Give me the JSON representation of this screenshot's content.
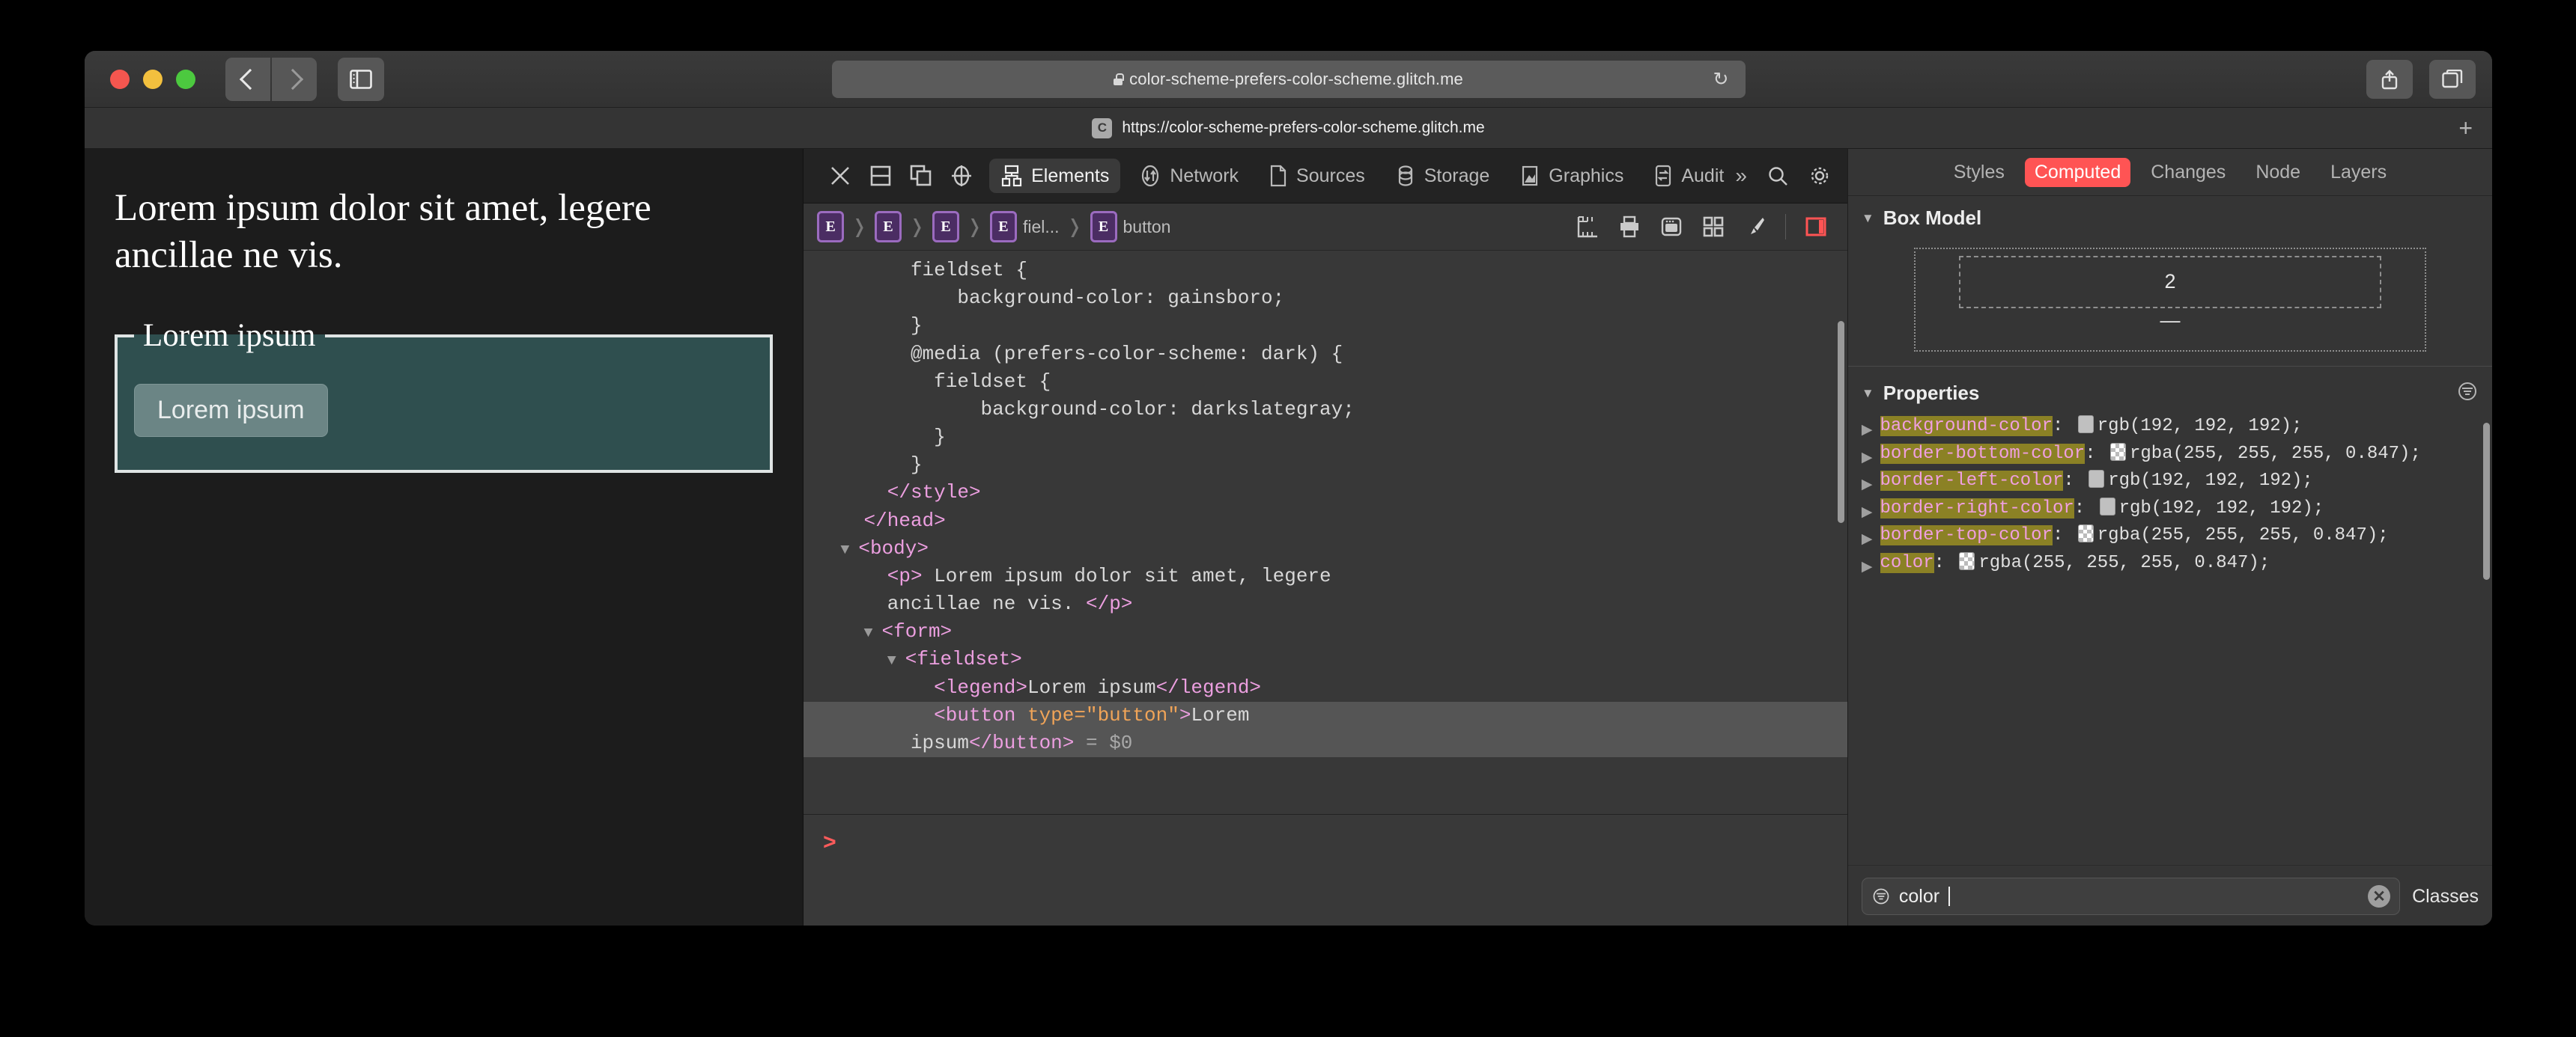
{
  "browser": {
    "url_display": "color-scheme-prefers-color-scheme.glitch.me",
    "reload_icon": "reload-icon",
    "lock_icon": "lock-icon",
    "share_icon": "share-icon",
    "tabs_icon": "tabs-overview-icon",
    "sidebar_icon": "sidebar-toggle-icon",
    "back_icon": "back-chevron-icon",
    "forward_icon": "forward-chevron-icon",
    "new_tab_label": "+",
    "tab": {
      "favicon_letter": "C",
      "title": "https://color-scheme-prefers-color-scheme.glitch.me"
    }
  },
  "page": {
    "paragraph": "Lorem ipsum dolor sit amet, legere ancillae ne vis.",
    "legend": "Lorem ipsum",
    "button_label": "Lorem ipsum",
    "fieldset_bg": "#2f4f4f",
    "border_color": "rgba(255, 255, 255, 0.847)"
  },
  "devtools": {
    "close_icon": "close-icon",
    "dock_bottom_icon": "dock-to-bottom-icon",
    "dock_side_icon": "dock-to-side-icon",
    "inspect_icon": "inspect-element-icon",
    "tabs": [
      {
        "label": "Elements",
        "icon": "elements-tree-icon",
        "active": true
      },
      {
        "label": "Network",
        "icon": "network-arrows-icon",
        "active": false
      },
      {
        "label": "Sources",
        "icon": "sources-document-icon",
        "active": false
      },
      {
        "label": "Storage",
        "icon": "storage-database-icon",
        "active": false
      },
      {
        "label": "Graphics",
        "icon": "graphics-image-icon",
        "active": false
      },
      {
        "label": "Audit",
        "icon": "audit-swap-icon",
        "active": false
      }
    ],
    "overflow_label": "»",
    "search_icon": "search-icon",
    "settings_icon": "gear-icon",
    "breadcrumb": [
      {
        "badge": "E",
        "label": ""
      },
      {
        "badge": "E",
        "label": ""
      },
      {
        "badge": "E",
        "label": ""
      },
      {
        "badge": "E",
        "label": "fiel..."
      },
      {
        "badge": "E",
        "label": "button"
      }
    ],
    "breadcrumb_icons": [
      "ruler-icon",
      "print-icon",
      "browser-window-icon",
      "grid-layout-icon",
      "paintbrush-icon",
      "layout-sidebar-icon"
    ],
    "dom_lines": [
      {
        "indent": 4,
        "parts": [
          {
            "t": "txt",
            "v": "fieldset {"
          }
        ]
      },
      {
        "indent": 6,
        "parts": [
          {
            "t": "txt",
            "v": "background-color: gainsboro;"
          }
        ]
      },
      {
        "indent": 4,
        "parts": [
          {
            "t": "txt",
            "v": "}"
          }
        ]
      },
      {
        "indent": 4,
        "parts": [
          {
            "t": "txt",
            "v": "@media (prefers-color-scheme: dark) {"
          }
        ]
      },
      {
        "indent": 5,
        "parts": [
          {
            "t": "txt",
            "v": "fieldset {"
          }
        ]
      },
      {
        "indent": 7,
        "parts": [
          {
            "t": "txt",
            "v": "background-color: darkslategray;"
          }
        ]
      },
      {
        "indent": 5,
        "parts": [
          {
            "t": "txt",
            "v": "}"
          }
        ]
      },
      {
        "indent": 4,
        "parts": [
          {
            "t": "txt",
            "v": "}"
          }
        ]
      },
      {
        "indent": 3,
        "parts": [
          {
            "t": "tag",
            "v": "</style>"
          }
        ]
      },
      {
        "indent": 2,
        "parts": [
          {
            "t": "tag",
            "v": "</head>"
          }
        ]
      },
      {
        "indent": 1,
        "tri": true,
        "parts": [
          {
            "t": "tag",
            "v": "<body>"
          }
        ]
      },
      {
        "indent": 3,
        "parts": [
          {
            "t": "tag",
            "v": "<p>"
          },
          {
            "t": "txt",
            "v": " Lorem ipsum dolor sit amet, legere"
          }
        ]
      },
      {
        "indent": 3,
        "parts": [
          {
            "t": "txt",
            "v": "ancillae ne vis. "
          },
          {
            "t": "tag",
            "v": "</p>"
          }
        ]
      },
      {
        "indent": 2,
        "tri": true,
        "parts": [
          {
            "t": "tag",
            "v": "<form>"
          }
        ]
      },
      {
        "indent": 3,
        "tri": true,
        "parts": [
          {
            "t": "tag",
            "v": "<fieldset>"
          }
        ]
      },
      {
        "indent": 5,
        "parts": [
          {
            "t": "tag",
            "v": "<legend>"
          },
          {
            "t": "txt",
            "v": "Lorem ipsum"
          },
          {
            "t": "tag",
            "v": "</legend>"
          }
        ]
      },
      {
        "indent": 5,
        "sel": true,
        "parts": [
          {
            "t": "tag",
            "v": "<button "
          },
          {
            "t": "attr",
            "v": "type=\"button\""
          },
          {
            "t": "tag",
            "v": ">"
          },
          {
            "t": "txt",
            "v": "Lorem"
          }
        ]
      },
      {
        "indent": 4,
        "sel": true,
        "parts": [
          {
            "t": "txt",
            "v": "ipsum"
          },
          {
            "t": "tag",
            "v": "</button>"
          },
          {
            "t": "dollar",
            "v": " = $0"
          }
        ]
      }
    ],
    "console_prompt": ">"
  },
  "sidebar": {
    "tabs": [
      {
        "label": "Styles",
        "active": false
      },
      {
        "label": "Computed",
        "active": true
      },
      {
        "label": "Changes",
        "active": false
      },
      {
        "label": "Node",
        "active": false
      },
      {
        "label": "Layers",
        "active": false
      }
    ],
    "active_tab_color": "#ff5454",
    "box_model": {
      "title": "Box Model",
      "top_value": "2",
      "bottom_value": "—"
    },
    "properties": {
      "title": "Properties",
      "filter_icon": "filter-icon",
      "items": [
        {
          "name": "background-color",
          "value": "rgb(192, 192, 192);",
          "swatch": "solid"
        },
        {
          "name": "border-bottom-color",
          "value": "rgba(255, 255, 255, 0.847);",
          "swatch": "alpha"
        },
        {
          "name": "border-left-color",
          "value": "rgb(192, 192, 192);",
          "swatch": "solid"
        },
        {
          "name": "border-right-color",
          "value": "rgb(192, 192, 192);",
          "swatch": "solid"
        },
        {
          "name": "border-top-color",
          "value": "rgba(255, 255, 255, 0.847);",
          "swatch": "alpha"
        },
        {
          "name": "color",
          "value": "rgba(255, 255, 255, 0.847);",
          "swatch": "alpha"
        }
      ]
    },
    "filter": {
      "value": "color",
      "icon": "filter-icon",
      "clear_label": "✕"
    },
    "classes_label": "Classes"
  }
}
